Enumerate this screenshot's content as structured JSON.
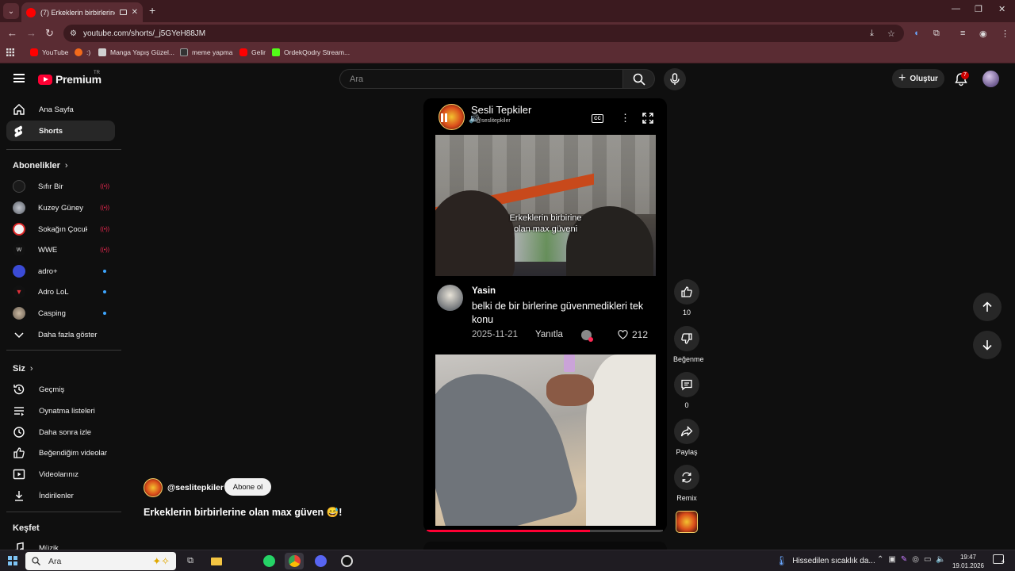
{
  "browser": {
    "tab_title": "(7) Erkeklerin birbirlerine ol...",
    "url": "youtube.com/shorts/_j5GYeH88JM",
    "bookmarks": [
      {
        "label": "YouTube",
        "color": "#ff0000"
      },
      {
        "label": ":)",
        "color": "#f26a1b"
      },
      {
        "label": "Manga Yapış Güzel...",
        "color": "#d0d0d0"
      },
      {
        "label": "meme yapma",
        "color": "#333333"
      },
      {
        "label": "Gelir",
        "color": "#ff0000"
      },
      {
        "label": "OrdekQodry Stream...",
        "color": "#53fc18"
      }
    ]
  },
  "header": {
    "logo_text": "Premium",
    "region": "TR",
    "search_placeholder": "Ara",
    "create_label": "Oluştur",
    "notification_count": "7"
  },
  "sidebar": {
    "main": [
      {
        "label": "Ana Sayfa",
        "icon": "home-icon"
      },
      {
        "label": "Shorts",
        "icon": "shorts-icon",
        "active": true
      }
    ],
    "subscriptions_heading": "Abonelikler",
    "subscriptions": [
      {
        "name": "Sıfır Bir",
        "status": "live",
        "color": "#1a1a1a"
      },
      {
        "name": "Kuzey Güney",
        "status": "live",
        "color": "#8a8f99"
      },
      {
        "name": "Sokağın Çocukları",
        "status": "live",
        "color": "#f2f2f2"
      },
      {
        "name": "WWE",
        "status": "live",
        "color": "#111111"
      },
      {
        "name": "adro+",
        "status": "new",
        "color": "#3b4bd6"
      },
      {
        "name": "Adro LoL",
        "status": "new",
        "color": "#111111"
      },
      {
        "name": "Casping",
        "status": "new",
        "color": "#9a8c7a"
      }
    ],
    "show_more": "Daha fazla göster",
    "you_heading": "Siz",
    "you_items": [
      {
        "label": "Geçmiş",
        "icon": "history-icon"
      },
      {
        "label": "Oynatma listeleri",
        "icon": "playlists-icon"
      },
      {
        "label": "Daha sonra izle",
        "icon": "watch-later-icon"
      },
      {
        "label": "Beğendiğim videolar",
        "icon": "liked-icon"
      },
      {
        "label": "Videolarınız",
        "icon": "your-videos-icon"
      },
      {
        "label": "İndirilenler",
        "icon": "downloads-icon"
      }
    ],
    "explore_heading": "Keşfet",
    "explore_items": [
      {
        "label": "Müzik",
        "icon": "music-icon"
      }
    ]
  },
  "player": {
    "channel_name": "Sesli Tepkiler",
    "channel_handle": "@seslitepkiler",
    "overlay_caption_line1": "Erkeklerin birbirine",
    "overlay_caption_line2": "olan max güveni",
    "comment": {
      "author": "Yasin",
      "text": "belki de bir birlerine güvenmedikleri tek konu",
      "date": "2025-11-21",
      "reply_label": "Yanıtla",
      "likes": "212"
    },
    "progress": 0.69
  },
  "actions": {
    "like_count": "10",
    "dislike_label": "Beğenme",
    "comment_count": "0",
    "share_label": "Paylaş",
    "remix_label": "Remix"
  },
  "video_info": {
    "channel_handle": "@seslitepkiler",
    "subscribe_label": "Abone ol",
    "title": "Erkeklerin birbirlerine olan max güven 😅!"
  },
  "taskbar": {
    "search_placeholder": "Ara",
    "weather_text": "Hissedilen sıcaklık da...",
    "time": "19:47",
    "date": "19.01.2026",
    "notification_count": "4"
  }
}
